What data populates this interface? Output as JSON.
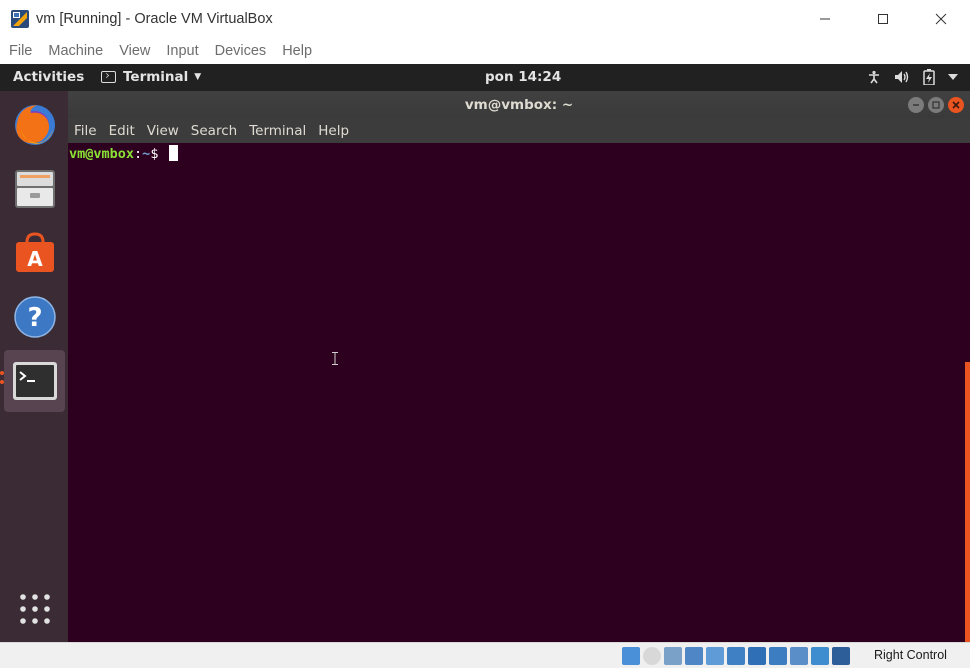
{
  "host_window": {
    "title": "vm [Running] - Oracle VM VirtualBox",
    "controls": [
      "minimize-icon",
      "maximize-icon",
      "close-icon"
    ],
    "menu": [
      "File",
      "Machine",
      "View",
      "Input",
      "Devices",
      "Help"
    ]
  },
  "gnome_topbar": {
    "activities": "Activities",
    "app_menu": "Terminal",
    "clock": "pon 14:24",
    "tray_icons": [
      "accessibility-icon",
      "volume-icon",
      "battery-icon",
      "system-menu-caret-icon"
    ]
  },
  "dock": {
    "items": [
      {
        "name": "Firefox",
        "icon": "firefox-icon"
      },
      {
        "name": "Files",
        "icon": "files-icon"
      },
      {
        "name": "Ubuntu Software",
        "icon": "software-icon"
      },
      {
        "name": "Help",
        "icon": "help-icon"
      },
      {
        "name": "Terminal",
        "icon": "terminal-icon",
        "active": true
      }
    ],
    "show_apps_icon": "show-applications-icon"
  },
  "terminal": {
    "title": "vm@vmbox: ~",
    "menu": [
      "File",
      "Edit",
      "View",
      "Search",
      "Terminal",
      "Help"
    ],
    "prompt_user": "vm@vmbox",
    "prompt_sep": ":",
    "prompt_path": "~",
    "prompt_symbol": "$ "
  },
  "statusbar": {
    "host_key_label": "Right Control",
    "icons": [
      "hard-disk-icon",
      "optical-drive-icon",
      "audio-icon",
      "network-icon",
      "usb-icon",
      "shared-folders-icon",
      "display-icon",
      "video-capture-icon",
      "cpu-icon",
      "mouse-integration-icon",
      "keyboard-capture-icon"
    ]
  },
  "colors": {
    "ubuntu_orange": "#e95420",
    "terminal_bg": "#2c001e",
    "prompt_user": "#8ae234",
    "prompt_path": "#729fcf"
  }
}
